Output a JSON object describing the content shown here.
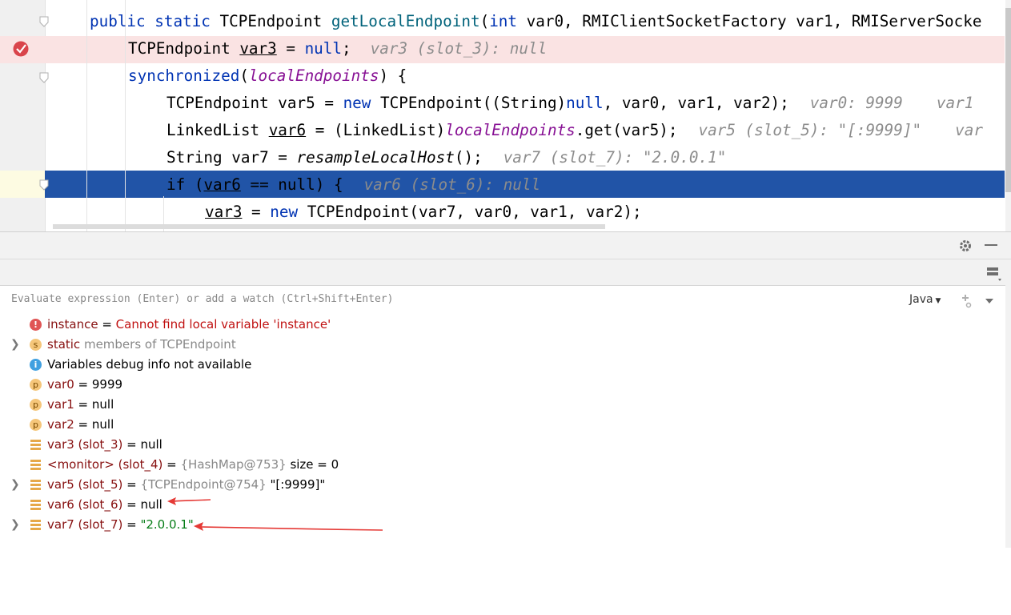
{
  "editor": {
    "lines": {
      "l1": {
        "kw1": "public static",
        "t1": " TCPEndpoint ",
        "fn": "getLocalEndpoint",
        "t2": "(",
        "kw2": "int",
        "t3": " var0, RMIClientSocketFactory var1, RMIServerSocke"
      },
      "l2": {
        "t1": "TCPEndpoint ",
        "var": "var3",
        "t2": " = ",
        "kw": "null",
        "t3": ";",
        "hint": "var3 (slot_3): null"
      },
      "l3": {
        "kw": "synchronized",
        "t1": "(",
        "fld": "localEndpoints",
        "t2": ") {"
      },
      "l4": {
        "t1": "TCPEndpoint var5 = ",
        "kw1": "new",
        "t2": " TCPEndpoint((String)",
        "kw2": "null",
        "t3": ", var0, var1, var2);",
        "hint1": "var0: 9999",
        "hint2": "var1"
      },
      "l5": {
        "t1": "LinkedList ",
        "var": "var6",
        "t2": " = (LinkedList)",
        "fld": "localEndpoints",
        "t3": ".get(var5);",
        "hint1": "var5 (slot_5): \"[:9999]\"",
        "hint2": "var"
      },
      "l6": {
        "t1": "String var7 = ",
        "it": "resampleLocalHost",
        "t2": "();",
        "hint": "var7 (slot_7): \"2.0.0.1\""
      },
      "l7": {
        "t1": "if (",
        "var": "var6",
        "t2": " == null) {",
        "hint": "var6 (slot_6): null"
      },
      "l8": {
        "var": "var3",
        "t1": " = ",
        "kw": "new",
        "t2": " TCPEndpoint(var7, var0, var1, var2);"
      }
    }
  },
  "evaluate": {
    "placeholder": "Evaluate expression (Enter) or add a watch (Ctrl+Shift+Enter)",
    "language": "Java"
  },
  "variables": [
    {
      "name": "instance",
      "eq": " = ",
      "value": "Cannot find local variable 'instance'"
    },
    {
      "name": "static",
      "rest": " members of TCPEndpoint"
    },
    {
      "text": "Variables debug info not available"
    },
    {
      "name": "var0",
      "eq": " = ",
      "value": "9999"
    },
    {
      "name": "var1",
      "eq": " = ",
      "value": "null"
    },
    {
      "name": "var2",
      "eq": " = ",
      "value": "null"
    },
    {
      "name": "var3 (slot_3)",
      "eq": " = ",
      "value": "null"
    },
    {
      "name": "<monitor> (slot_4)",
      "eq": " = ",
      "ref": "{HashMap@753}",
      "value": " size = 0"
    },
    {
      "name": "var5 (slot_5)",
      "eq": " = ",
      "ref": "{TCPEndpoint@754}",
      "value": " \"[:9999]\""
    },
    {
      "name": "var6 (slot_6)",
      "eq": " = ",
      "value": "null"
    },
    {
      "name": "var7 (slot_7)",
      "eq": " = ",
      "value": "\"2.0.0.1\""
    }
  ],
  "badges": {
    "err": "!",
    "info": "i",
    "s": "s",
    "p": "p"
  },
  "icons": {
    "breakpoint": "breakpoint-icon",
    "settings": "gear-icon",
    "minimize": "minimize-icon",
    "layout": "layout-icon",
    "watch": "add-watch-icon",
    "dropdown": "chevron-down-icon"
  },
  "colors": {
    "current_line": "#2154a7",
    "breakpoint_line": "#fae3e3",
    "arrow": "#e53935"
  }
}
